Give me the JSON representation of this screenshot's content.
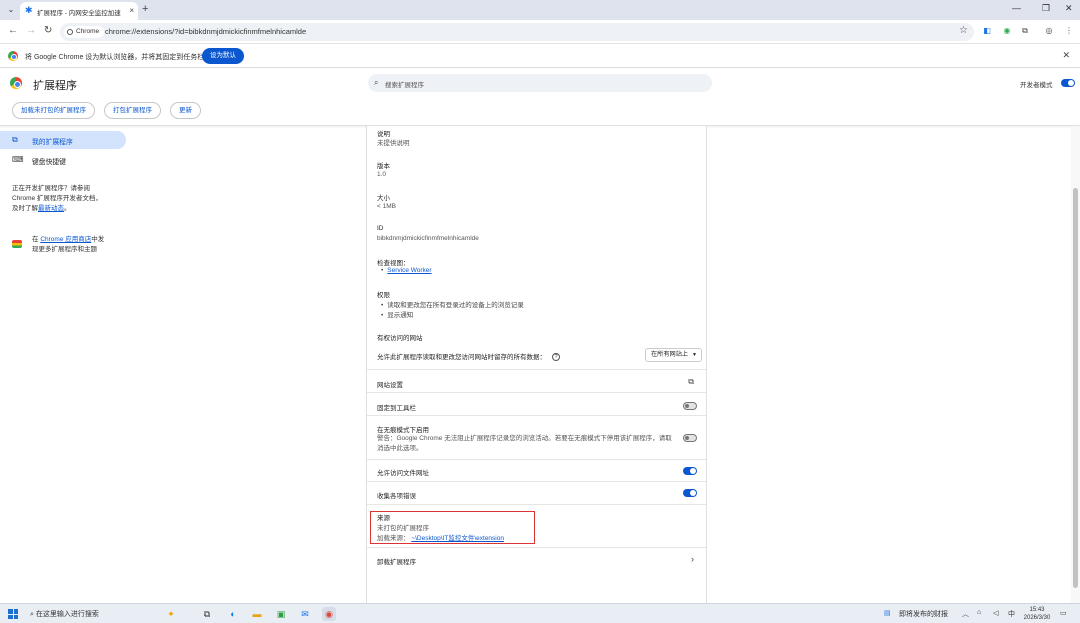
{
  "browser": {
    "tab_title": "扩展程序 - 内网安全监控加速",
    "tab_menu_icon": "chevron-down-icon",
    "new_tab_icon": "+",
    "omnibox_chip": "Chrome",
    "url": "chrome://extensions/?id=bibkdnmjdmickicfinmfmelnhicamlde"
  },
  "infobar": {
    "message": "将 Google Chrome 设为默认浏览器，并将其固定到任务栏",
    "button": "设为默认"
  },
  "header": {
    "title": "扩展程序",
    "search_placeholder": "搜索扩展程序",
    "dev_mode_label": "开发者模式",
    "dev_mode_on": true,
    "buttons": [
      "加载未打包的扩展程序",
      "打包扩展程序",
      "更新"
    ]
  },
  "sidebar": {
    "items": [
      {
        "label": "我的扩展程序",
        "icon": "puzzle-icon",
        "active": true
      },
      {
        "label": "键盘快捷键",
        "icon": "keyboard-icon",
        "active": false
      }
    ],
    "dev_note_1": "正在开发扩展程序？请参阅",
    "dev_note_2": "Chrome 扩展程序开发者文档，",
    "dev_note_3_pre": "及时了解",
    "dev_note_3_link": "最新动态",
    "dev_note_3_post": "。",
    "store_pre": "在 ",
    "store_link": "Chrome 应用商店",
    "store_post_1": "中发",
    "store_post_2": "现更多扩展程序和主题"
  },
  "details": {
    "desc_label": "说明",
    "desc_value": "未提供说明",
    "version_label": "版本",
    "version_value": "1.0",
    "size_label": "大小",
    "size_value": "< 1MB",
    "id_label": "ID",
    "id_value": "bibkdnmjdmickicfinmfmelnhicamlde",
    "inspect_label": "检查视图：",
    "inspect_link": "Service Worker",
    "perm_label": "权限",
    "permissions": [
      "读取和更改您在所有登录过的设备上的浏览记录",
      "显示通知"
    ],
    "site_access_label": "有权访问的网站",
    "site_access_text": "允许此扩展程序读取和更改您访问网站时留存的所有数据：",
    "site_access_select": "在所有网站上",
    "site_settings": "网站设置",
    "pin_label": "固定到工具栏",
    "pin_on": false,
    "incognito_title": "在无痕模式下启用",
    "incognito_warning_1": "警告：Google Chrome 无法阻止扩展程序记录您的浏览活动。若要在无痕模式下停用该扩展程序，请取",
    "incognito_warning_2": "消选中此选项。",
    "incognito_on": false,
    "file_url_label": "允许访问文件网址",
    "file_url_on": true,
    "errors_label": "收集各项错误",
    "errors_on": true,
    "source_label": "来源",
    "source_value": "未打包的扩展程序",
    "load_from_label": "加载来源：",
    "load_from_path": "~\\Desktop\\IT监控文件\\extension",
    "remove_label": "卸载扩展程序"
  },
  "taskbar": {
    "search_placeholder": "在这里输入进行搜索",
    "news_label": "即将发布的财报",
    "ime": "中",
    "time": "15:43",
    "date": "2026/3/30"
  },
  "colors": {
    "accent": "#0b57d0",
    "highlight_box": "#dd3333"
  }
}
